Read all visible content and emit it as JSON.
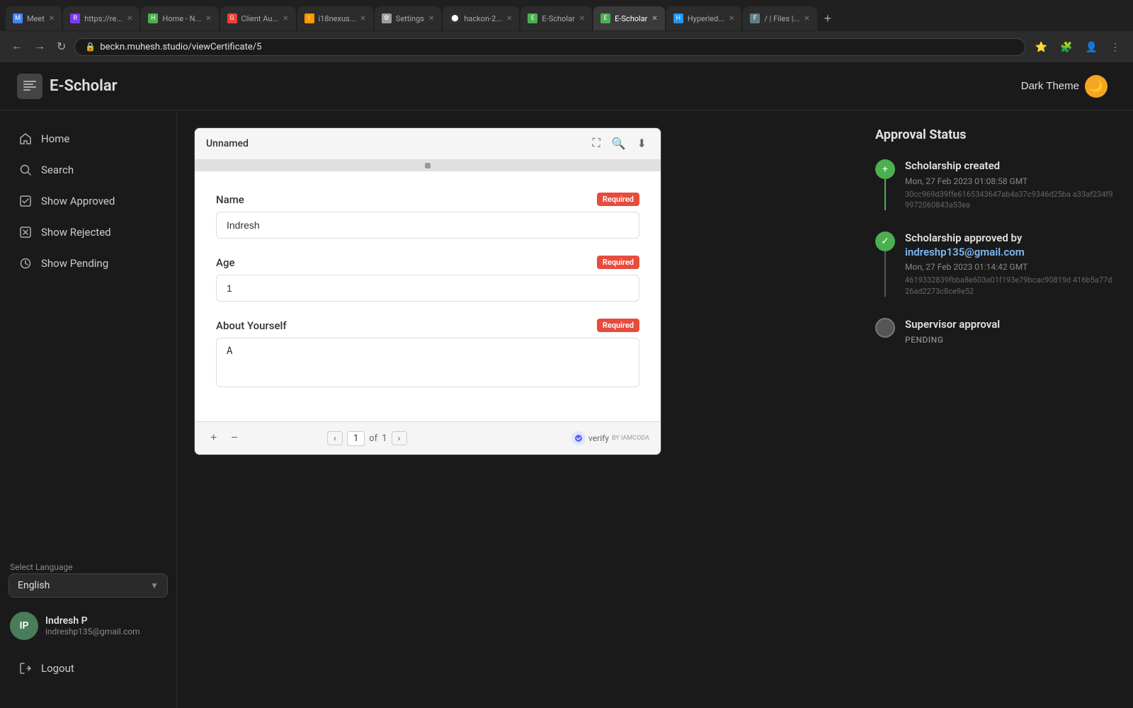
{
  "browser": {
    "url": "beckn.muhesh.studio/viewCertificate/5",
    "tabs": [
      {
        "id": "meet",
        "label": "Meet",
        "favicon_color": "#4285f4",
        "favicon_char": "M",
        "active": false
      },
      {
        "id": "https",
        "label": "https://re...",
        "active": false
      },
      {
        "id": "home",
        "label": "Home - N...",
        "favicon_color": "#4caf50",
        "favicon_char": "H",
        "active": false
      },
      {
        "id": "gmail",
        "label": "Client Au...",
        "favicon_color": "#ea4335",
        "favicon_char": "G",
        "active": false
      },
      {
        "id": "i18nexus",
        "label": "i18nexus...",
        "favicon_color": "#ff9800",
        "favicon_char": "i",
        "active": false
      },
      {
        "id": "settings",
        "label": "Settings",
        "favicon_color": "#9e9e9e",
        "favicon_char": "⚙",
        "active": false
      },
      {
        "id": "github",
        "label": "hackon-2...",
        "favicon_color": "#333",
        "favicon_char": "⬤",
        "active": false
      },
      {
        "id": "escholar1",
        "label": "E-Scholar",
        "favicon_color": "#4caf50",
        "favicon_char": "E",
        "active": false
      },
      {
        "id": "escholar2",
        "label": "E-Scholar",
        "favicon_color": "#4caf50",
        "favicon_char": "E",
        "active": true
      },
      {
        "id": "hyperled",
        "label": "Hyperled...",
        "favicon_color": "#2196f3",
        "favicon_char": "H",
        "active": false
      },
      {
        "id": "files",
        "label": "/ | Files |...",
        "favicon_color": "#607d8b",
        "favicon_char": "F",
        "active": false
      }
    ]
  },
  "header": {
    "logo_text": "E-Scholar",
    "dark_theme_label": "Dark Theme"
  },
  "sidebar": {
    "nav_items": [
      {
        "id": "home",
        "label": "Home",
        "icon": "🏠"
      },
      {
        "id": "search",
        "label": "Search",
        "icon": "🔍"
      },
      {
        "id": "show-approved",
        "label": "Show Approved",
        "icon": "📋"
      },
      {
        "id": "show-rejected",
        "label": "Show Rejected",
        "icon": "📋"
      },
      {
        "id": "show-pending",
        "label": "Show Pending",
        "icon": "📋"
      }
    ],
    "language_label": "Select Language",
    "language_value": "English",
    "user": {
      "initials": "IP",
      "name": "Indresh P",
      "email": "indreshp135@gmail.com"
    },
    "logout_label": "Logout"
  },
  "certificate": {
    "window_title": "Unnamed",
    "fields": [
      {
        "label": "Name",
        "required": true,
        "required_text": "Required",
        "value": "Indresh",
        "type": "input"
      },
      {
        "label": "Age",
        "required": true,
        "required_text": "Required",
        "value": "1",
        "type": "input"
      },
      {
        "label": "About Yourself",
        "required": true,
        "required_text": "Required",
        "value": "A",
        "type": "textarea"
      }
    ],
    "page_current": "1",
    "page_total": "1",
    "page_of": "of",
    "verify_text": "verify"
  },
  "approval": {
    "title": "Approval Status",
    "timeline": [
      {
        "id": "created",
        "status": "done",
        "event_title": "Scholarship created",
        "timestamp": "Mon, 27 Feb 2023 01:08:58 GMT",
        "hash": "30cc969d39ffe6165343647ab4a37c9346d25ba a33af234f99972060843a53ea"
      },
      {
        "id": "approved",
        "status": "done",
        "event_title_prefix": "Scholarship approved by ",
        "event_title_link": "indreshp135@gmail.com",
        "timestamp": "Mon, 27 Feb 2023 01:14:42 GMT",
        "hash": "4619332839fbba8e603a01f193e79bcac90819d 416b5a77d26ad2273c8ce9e52"
      },
      {
        "id": "supervisor",
        "status": "pending",
        "event_title": "Supervisor approval",
        "status_label": "PENDING"
      }
    ]
  }
}
